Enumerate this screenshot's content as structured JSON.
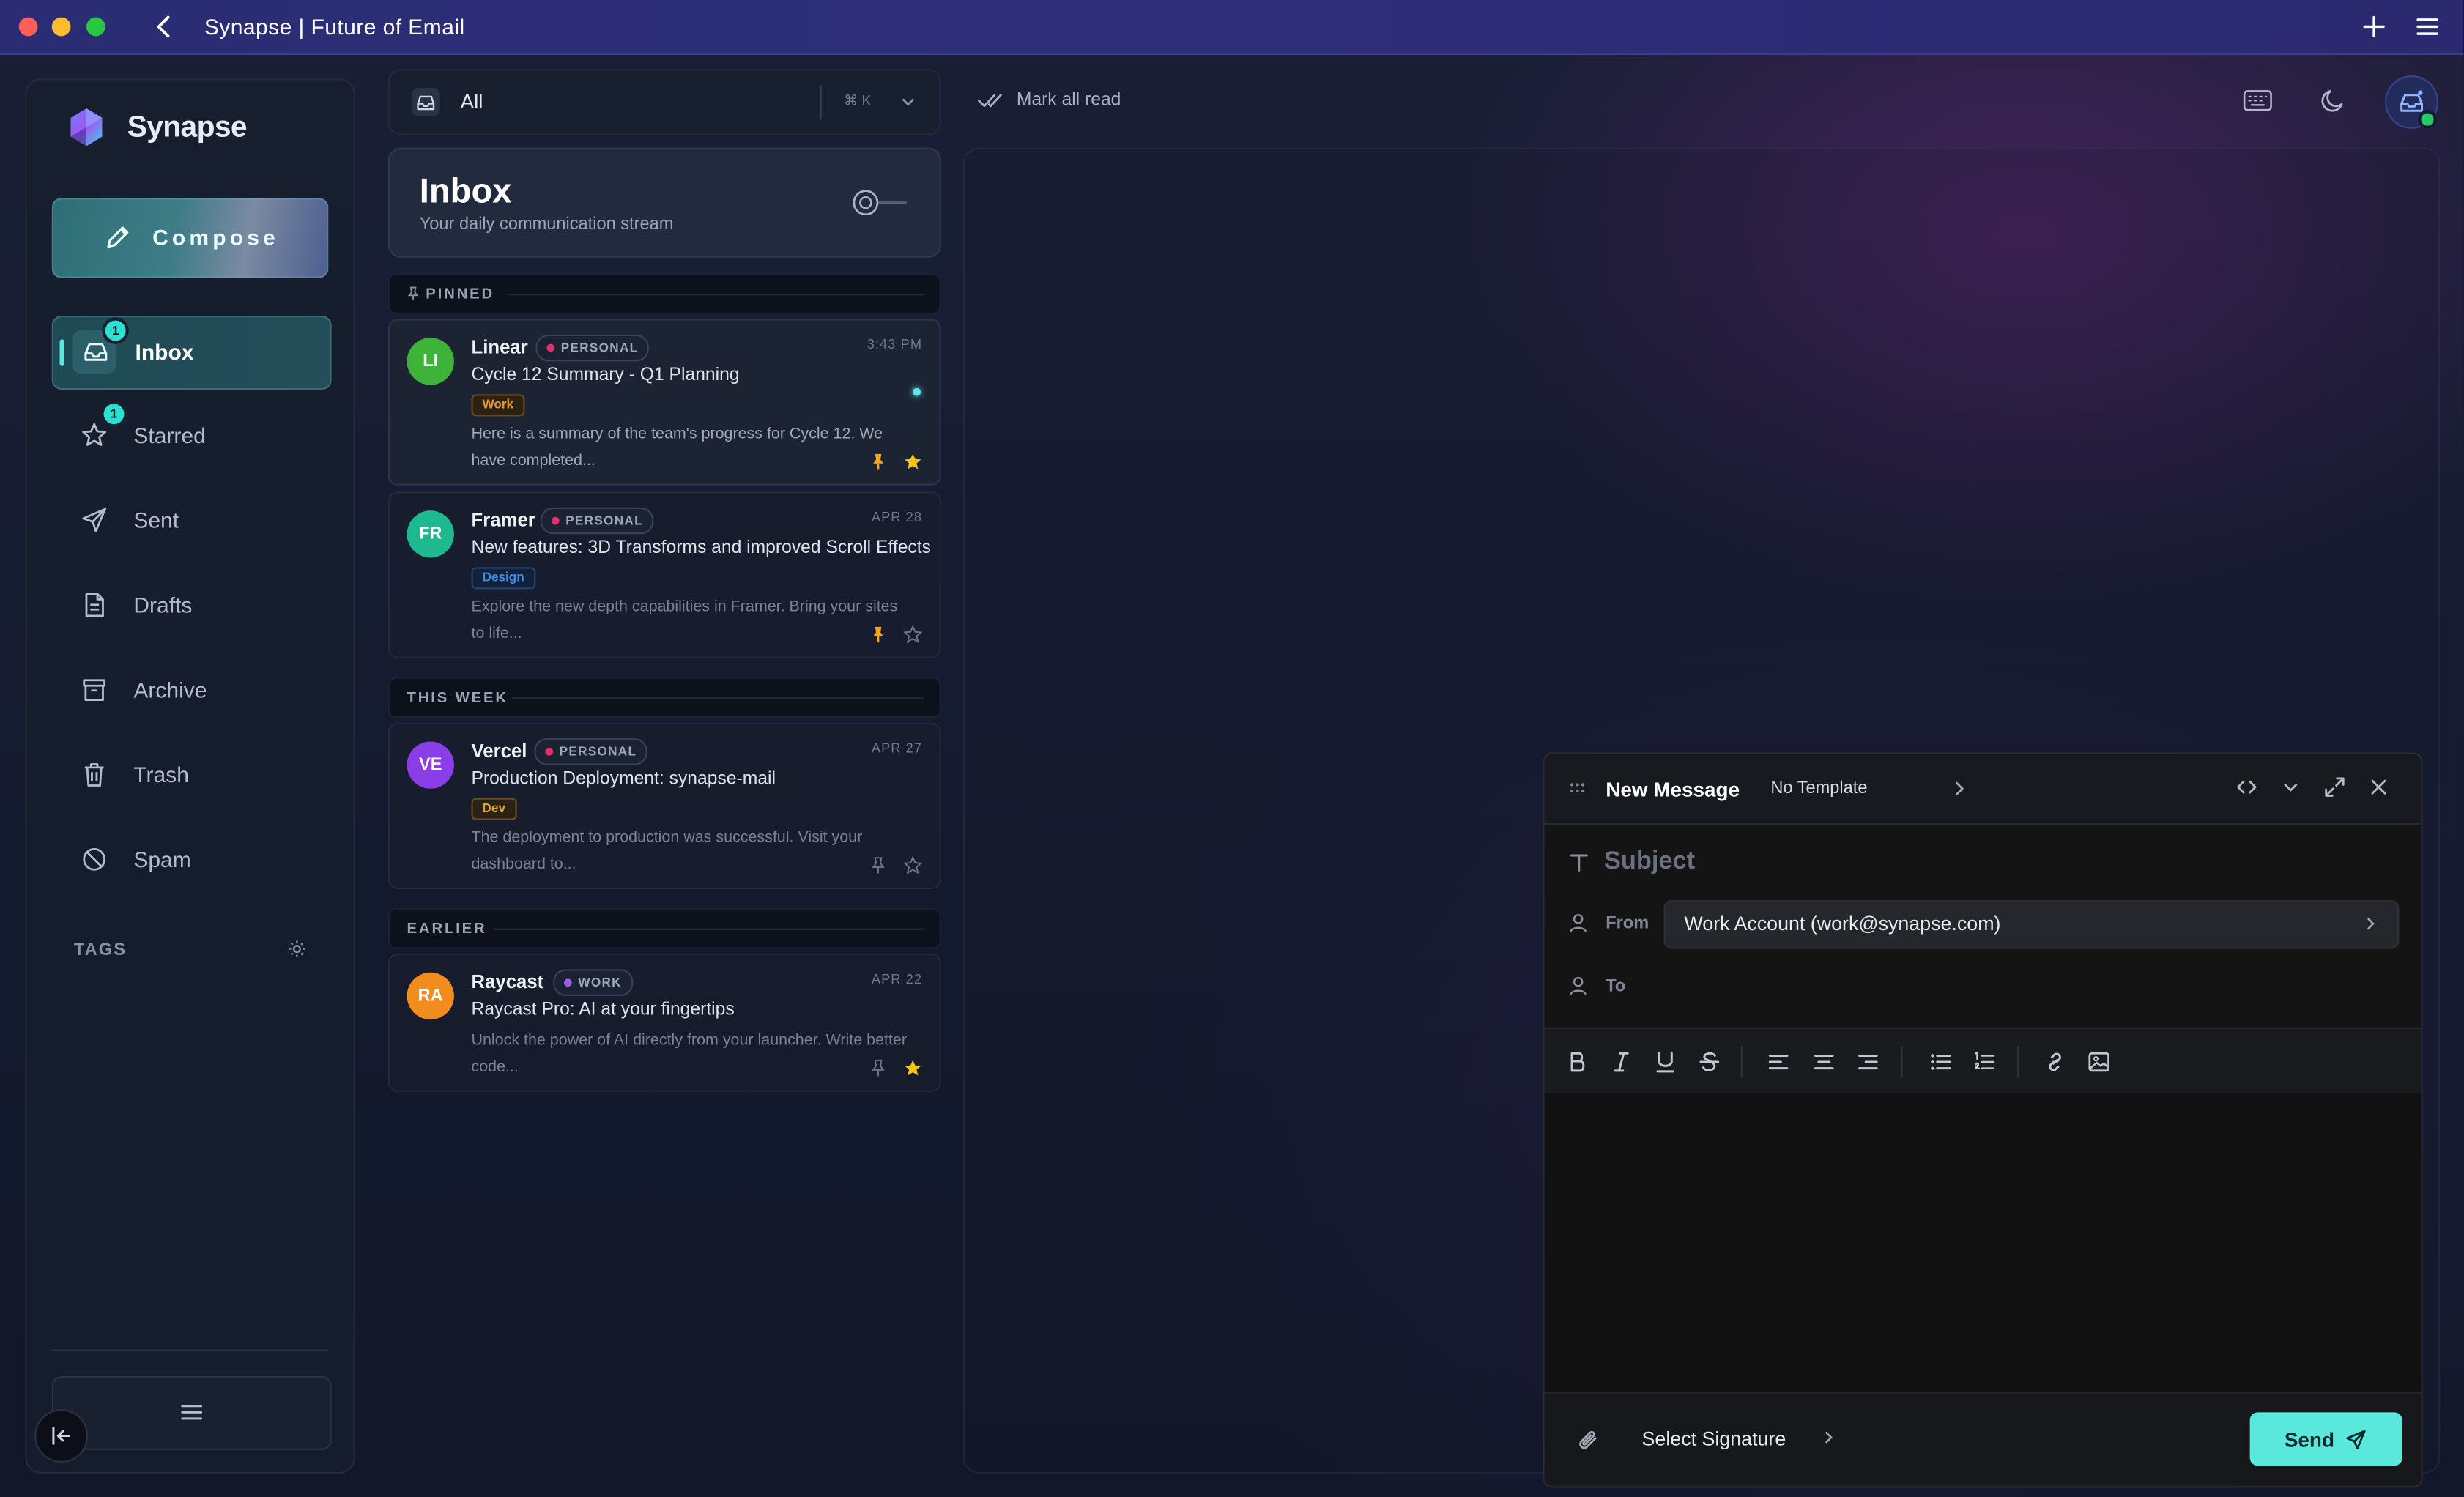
{
  "window": {
    "title": "Synapse | Future of Email"
  },
  "colors": {
    "accent": "#5ae8dd",
    "titlebar": "#2e2d7a",
    "pinned": "#f5a524",
    "star": "#f5c518"
  },
  "sidebar": {
    "brand": "Synapse",
    "compose_label": "Compose",
    "items": [
      {
        "label": "Inbox",
        "icon": "inbox-icon",
        "badge": "1",
        "active": true
      },
      {
        "label": "Starred",
        "icon": "star-icon",
        "badge": "1"
      },
      {
        "label": "Sent",
        "icon": "send-icon"
      },
      {
        "label": "Drafts",
        "icon": "file-icon"
      },
      {
        "label": "Archive",
        "icon": "archive-icon"
      },
      {
        "label": "Trash",
        "icon": "trash-icon"
      },
      {
        "label": "Spam",
        "icon": "ban-icon"
      }
    ],
    "tags_label": "TAGS"
  },
  "list": {
    "filter": {
      "label": "All",
      "shortcut": "⌘ K"
    },
    "header": {
      "title": "Inbox",
      "subtitle": "Your daily communication stream"
    },
    "sections": {
      "pinned": "PINNED",
      "this_week": "THIS WEEK",
      "earlier": "EARLIER"
    },
    "emails": [
      {
        "initials": "LI",
        "avatar_color": "#3fb23a",
        "sender": "Linear",
        "category": "PERSONAL",
        "category_dot": "#e0306f",
        "time": "3:43 PM",
        "subject": "Cycle 12 Summary - Q1 Planning",
        "tag": "Work",
        "tag_color": "#e39a2d",
        "preview_1": "Here is a summary of the team's progress for Cycle 12. We",
        "preview_2": "have completed...",
        "pinned": true,
        "starred": true,
        "unread": true
      },
      {
        "initials": "FR",
        "avatar_color": "#1fb98f",
        "sender": "Framer",
        "category": "PERSONAL",
        "category_dot": "#e0306f",
        "time": "APR 28",
        "subject": "New features: 3D Transforms and improved Scroll Effects",
        "tag": "Design",
        "tag_color": "#3d8fe6",
        "preview_1": "Explore the new depth capabilities in Framer. Bring your sites",
        "preview_2": "to life...",
        "pinned": true,
        "starred": false
      },
      {
        "initials": "VE",
        "avatar_color": "#8a3ee8",
        "sender": "Vercel",
        "category": "PERSONAL",
        "category_dot": "#e0306f",
        "time": "APR 27",
        "subject": "Production Deployment: synapse-mail",
        "tag": "Dev",
        "tag_color": "#e3a42d",
        "preview_1": "The deployment to production was successful. Visit your",
        "preview_2": "dashboard to...",
        "pinned": false,
        "starred": false
      },
      {
        "initials": "RA",
        "avatar_color": "#f28c1c",
        "sender": "Raycast",
        "category": "WORK",
        "category_dot": "#9b5cf0",
        "time": "APR 22",
        "subject": "Raycast Pro: AI at your fingertips",
        "preview_1": "Unlock the power of AI directly from your launcher. Write better",
        "preview_2": "code...",
        "pinned": false,
        "starred": true
      }
    ]
  },
  "main": {
    "mark_all_read": "Mark all read"
  },
  "composer": {
    "title": "New Message",
    "template": "No Template",
    "subject_placeholder": "Subject",
    "from_label": "From",
    "from_value": "Work Account (work@synapse.com)",
    "to_label": "To",
    "signature": "Select Signature",
    "send_label": "Send"
  }
}
